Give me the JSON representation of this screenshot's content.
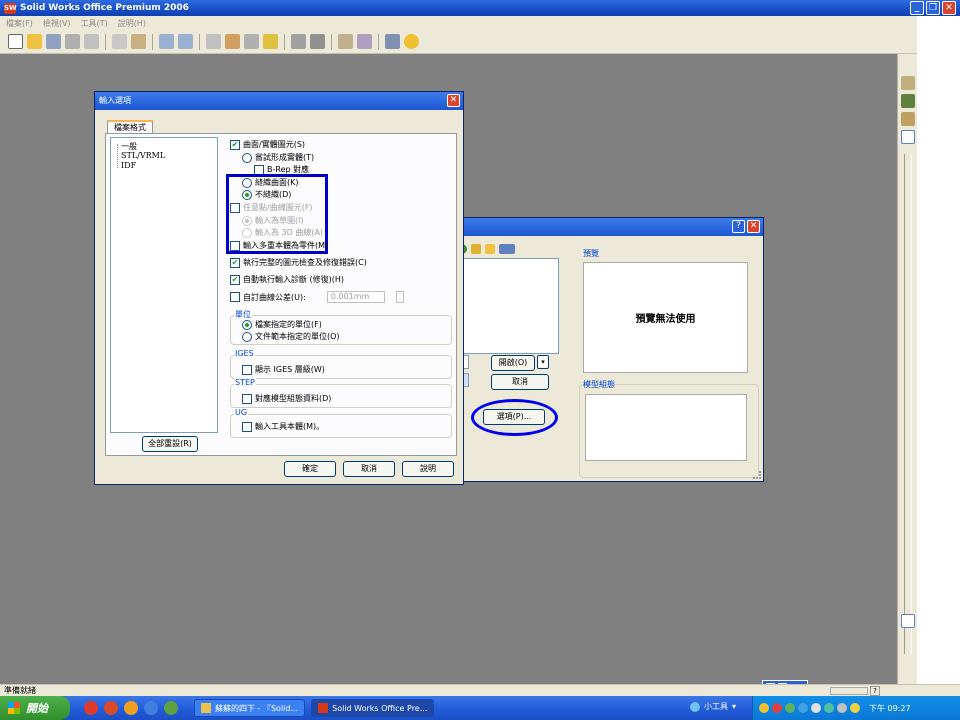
{
  "window": {
    "title": "Solid Works Office Premium 2006"
  },
  "menu": [
    "檔案(F)",
    "檢視(V)",
    "工具(T)",
    "說明(H)"
  ],
  "open_dialog": {
    "preview_legend": "預覽",
    "preview_text": "預覽無法使用",
    "assembly_legend": "模型組態",
    "open_label": "開啟(O)",
    "cancel_label": "取消",
    "options_label": "選項(P)..."
  },
  "options_dialog": {
    "title": "輸入選項",
    "tab": "檔案格式",
    "tree": [
      "一般",
      "STL/VRML",
      "IDF"
    ],
    "surface_solid": "曲面/實體圖元(S)",
    "try_solid": "嘗試形成實體(T)",
    "brep_map": "B-Rep 對應",
    "knit_surfaces": "縫織曲面(K)",
    "no_knit": "不縫織(D)",
    "free_point": "任意點/曲線圖元(F)",
    "import_sketch": "輸入為草圖(I)",
    "import_3d_curve": "輸入為 3D 曲線(A)",
    "multi_body": "輸入多重本體為零件(M)",
    "full_check": "執行完整的圖元檢查及修復錯誤(C)",
    "auto_diagnose": "自動執行輸入診斷 (修復)(H)",
    "custom_tolerance": "自訂曲線公差(U):",
    "tolerance_value": "0.001mm",
    "units_legend": "單位",
    "units_file": "檔案指定的單位(F)",
    "units_template": "文件範本指定的單位(O)",
    "iges_legend": "IGES",
    "iges_layers": "顯示 IGES 層級(W)",
    "step_legend": "STEP",
    "step_config": "對應模型組態資料(D)",
    "ug_legend": "UG",
    "ug_bodies": "輸入工具本體(M)。",
    "reset_all": "全部重設(R)",
    "ok": "確定",
    "cancel": "取消",
    "help": "說明"
  },
  "status": {
    "text": "準備就緒"
  },
  "taskbar": {
    "start": "開始",
    "items": [
      "蘇蘇的四下 - 『Solid...",
      "Solid Works Office Pre..."
    ],
    "tools": "小工具",
    "clock": "下午 09:27"
  }
}
